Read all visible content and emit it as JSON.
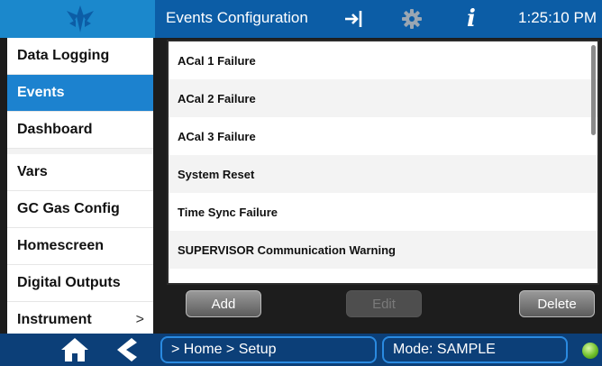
{
  "header": {
    "title": "Events Configuration",
    "time": "1:25:10 PM",
    "icons": [
      "logo-icon",
      "sign-out-icon",
      "gear-icon",
      "info-icon"
    ]
  },
  "sidebar": {
    "items": [
      {
        "label": "Data Logging",
        "active": false
      },
      {
        "label": "Events",
        "active": true
      },
      {
        "label": "Dashboard",
        "active": false
      },
      {
        "label": "Vars",
        "active": false
      },
      {
        "label": "GC Gas Config",
        "active": false
      },
      {
        "label": "Homescreen",
        "active": false
      },
      {
        "label": "Digital Outputs",
        "active": false
      },
      {
        "label": "Instrument",
        "active": false,
        "chevron": ">"
      }
    ]
  },
  "events": {
    "rows": [
      "ACal 1 Failure",
      "ACal 2 Failure",
      "ACal 3 Failure",
      "System Reset",
      "Time Sync Failure",
      "SUPERVISOR Communication Warning"
    ]
  },
  "buttons": {
    "add": "Add",
    "edit": "Edit",
    "delete": "Delete"
  },
  "footer": {
    "breadcrumb": "> Home > Setup",
    "mode": "Mode: SAMPLE"
  },
  "colors": {
    "header_bg": "#0c5da6",
    "active_item": "#1c82cf",
    "footer_bg": "#0c3f78",
    "status_led": "#6fbf2a"
  }
}
